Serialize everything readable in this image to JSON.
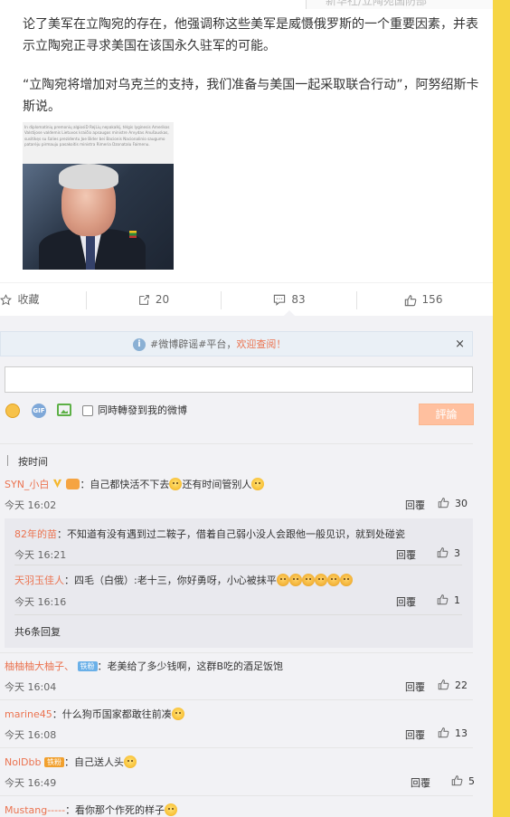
{
  "top_ghost_text": "新华社/立陶宛国防部",
  "article": {
    "para1": "论了美军在立陶宛的存在，他强调称这些美军是威慑俄罗斯的一个重要因素，并表示立陶宛正寻求美国在该国永久驻军的可能。",
    "para2": "“立陶宛将增加对乌克兰的支持，我们准备与美国一起采取联合行动”，阿努绍斯卡斯说。",
    "photo_caption_text": "In diplomatinių premonių algiosiD RejLių nepakalkį, tėlgis lyginesis Amerikos Valstijose valdemis Lietuvos kraičio apsaugos ministre Arvydas Anušauskas, susitikęs su šalies prezidentu Joe Bider bei Bacionis Nacionalinio saugumo patarėju pirmauju pasakoitis ministra Rimeria Dzonatalu Faimenu."
  },
  "actions": {
    "favorite_label": "收藏",
    "repost_count": "20",
    "comment_count": "83",
    "like_count": "156"
  },
  "comment_box": {
    "notice_prefix": "#微博辟谣#平台，",
    "notice_link": "欢迎查阅！",
    "close": "×",
    "input_value": "",
    "also_repost_label": "同時轉發到我的微博",
    "submit_label": "評論",
    "sort_label": "按时间"
  },
  "comments": [
    {
      "user": "SYN_小白",
      "text": "：自己都快活不下去",
      "text2": "还有时间管别人",
      "time": "今天 16:02",
      "reply": "回覆",
      "likes": "30"
    },
    {
      "user": "柚柚柚大柚子、",
      "badge": "铁粉",
      "text": "：老美给了多少钱啊，这群B吃的酒足饭饱",
      "time": "今天 16:04",
      "reply": "回覆",
      "likes": "22"
    },
    {
      "user": "marine45",
      "text": "：什么狗币国家都敢往前凑",
      "time": "今天 16:08",
      "reply": "回覆",
      "likes": "13"
    },
    {
      "user": "NolDbb",
      "badge": "铁粉",
      "text": "：自己送人头",
      "time": "今天 16:49",
      "reply": "回覆",
      "likes": "5"
    },
    {
      "user": "Mustang-----",
      "text": "：看你那个作死的样子"
    }
  ],
  "sub_comments": [
    {
      "user": "82年的苗",
      "text": "：不知道有没有遇到过二鞍子，借着自己弱小没人会跟他一般见识，就到处碰瓷",
      "time": "今天 16:21",
      "reply": "回覆",
      "likes": "3"
    },
    {
      "user": "天羽玉佳人",
      "text": "：四毛（白俄）:老十三，你好勇呀，小心被抹平",
      "time": "今天 16:16",
      "reply": "回覆",
      "likes": "1"
    }
  ],
  "sub_more": "共6条回复",
  "colors": {
    "accent": "#eb7350",
    "sidebar": "#f6d544",
    "submit": "#ffc09f"
  }
}
